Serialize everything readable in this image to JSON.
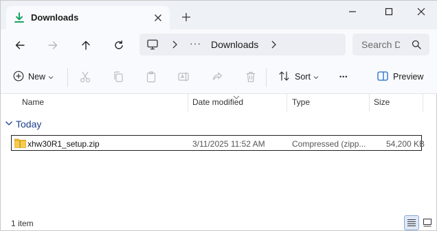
{
  "tab": {
    "title": "Downloads"
  },
  "address": {
    "location": "Downloads",
    "overflow": "···"
  },
  "search": {
    "placeholder": "Search D"
  },
  "commands": {
    "new_label": "New",
    "sort_label": "Sort",
    "more": "•••",
    "preview_label": "Preview"
  },
  "columns": {
    "name": "Name",
    "date": "Date modified",
    "type": "Type",
    "size": "Size"
  },
  "groups": [
    {
      "label": "Today"
    }
  ],
  "files": [
    {
      "name": "xhw30R1_setup.zip",
      "date": "3/11/2025 11:52 AM",
      "type": "Compressed (zipp...",
      "size": "54,200 KB"
    }
  ],
  "status": {
    "item_count": "1 item"
  },
  "colors": {
    "accent": "#1b6ac9",
    "folder_green": "#1aa260",
    "zip_yellow": "#f2b824",
    "group_text": "#1b3f8c"
  }
}
